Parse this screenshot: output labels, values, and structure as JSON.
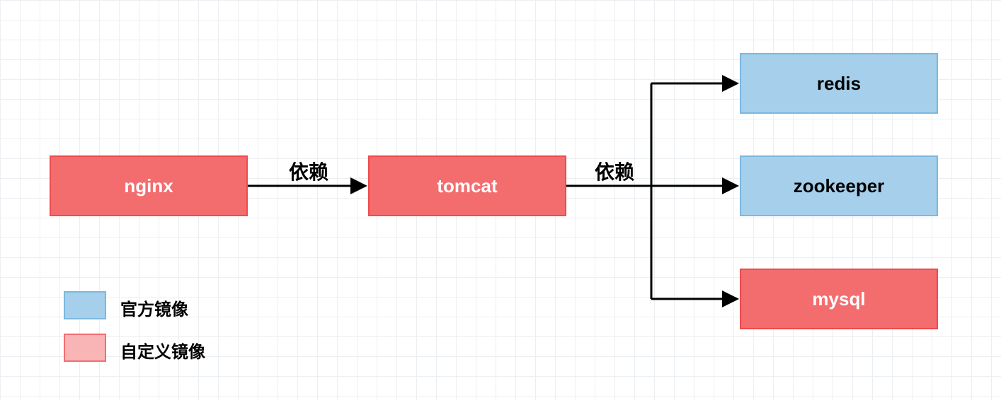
{
  "nodes": {
    "nginx": {
      "label": "nginx",
      "type": "custom"
    },
    "tomcat": {
      "label": "tomcat",
      "type": "custom"
    },
    "redis": {
      "label": "redis",
      "type": "official"
    },
    "zookeeper": {
      "label": "zookeeper",
      "type": "official"
    },
    "mysql": {
      "label": "mysql",
      "type": "custom"
    }
  },
  "edges": {
    "nginx_tomcat": {
      "label": "依赖"
    },
    "tomcat_services": {
      "label": "依赖"
    }
  },
  "legend": {
    "official": "官方镜像",
    "custom": "自定义镜像"
  },
  "colors": {
    "red_fill": "#f36d6f",
    "red_border": "#ef4a4d",
    "blue_fill": "#a5cfeb",
    "blue_border": "#7bb8e0",
    "swatch_red_fill": "#f9b5b6",
    "swatch_red_border": "#f36d6f"
  },
  "diagram": {
    "description": "Dependency diagram: nginx depends on tomcat; tomcat depends on redis, zookeeper, and mysql. Red boxes = custom images, blue boxes = official images."
  }
}
